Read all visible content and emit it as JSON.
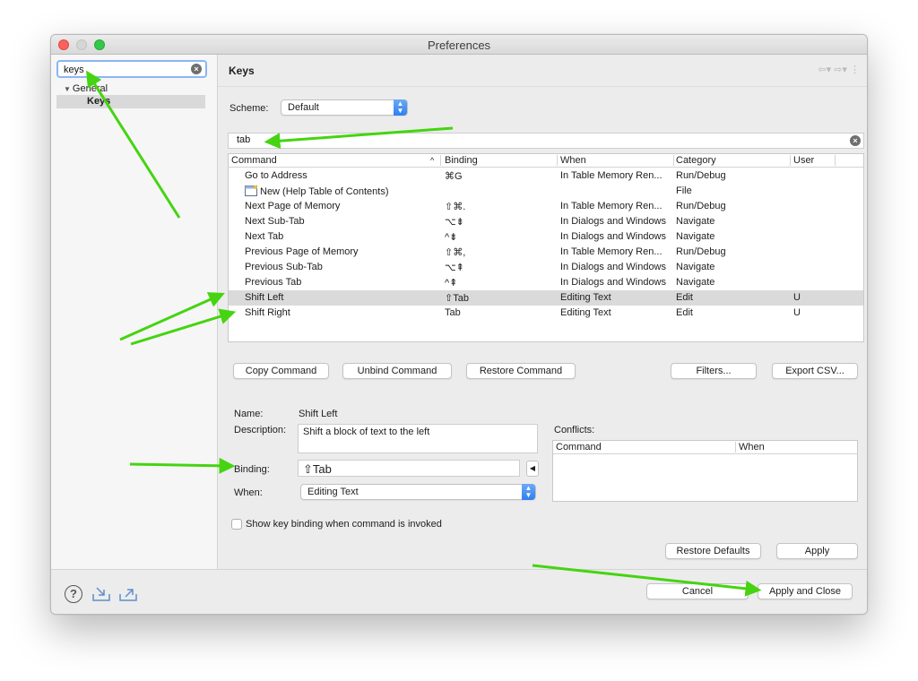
{
  "window": {
    "title": "Preferences"
  },
  "sidebar": {
    "filter_value": "keys",
    "tree": {
      "group": "General",
      "selected_item": "Keys"
    }
  },
  "page": {
    "title": "Keys"
  },
  "scheme": {
    "label": "Scheme:",
    "value": "Default"
  },
  "filter": {
    "value": "tab"
  },
  "table": {
    "columns": [
      "Command",
      "Binding",
      "When",
      "Category",
      "User"
    ],
    "rows": [
      {
        "command": "Go to Address",
        "binding": "⌘G",
        "when": "In Table Memory Ren...",
        "category": "Run/Debug",
        "user": ""
      },
      {
        "command": "New (Help Table of Contents)",
        "binding": "",
        "when": "",
        "category": "File",
        "user": "",
        "icon": "help-contents-icon"
      },
      {
        "command": "Next Page of Memory",
        "binding": "⇧⌘.",
        "when": "In Table Memory Ren...",
        "category": "Run/Debug",
        "user": ""
      },
      {
        "command": "Next Sub-Tab",
        "binding": "⌥⇟",
        "when": "In Dialogs and Windows",
        "category": "Navigate",
        "user": ""
      },
      {
        "command": "Next Tab",
        "binding": "^⇟",
        "when": "In Dialogs and Windows",
        "category": "Navigate",
        "user": ""
      },
      {
        "command": "Previous Page of Memory",
        "binding": "⇧⌘,",
        "when": "In Table Memory Ren...",
        "category": "Run/Debug",
        "user": ""
      },
      {
        "command": "Previous Sub-Tab",
        "binding": "⌥⇞",
        "when": "In Dialogs and Windows",
        "category": "Navigate",
        "user": ""
      },
      {
        "command": "Previous Tab",
        "binding": "^⇞",
        "when": "In Dialogs and Windows",
        "category": "Navigate",
        "user": ""
      },
      {
        "command": "Shift Left",
        "binding": "⇧Tab",
        "when": "Editing Text",
        "category": "Edit",
        "user": "U",
        "selected": true
      },
      {
        "command": "Shift Right",
        "binding": "Tab",
        "when": "Editing Text",
        "category": "Edit",
        "user": "U"
      }
    ]
  },
  "buttons": {
    "copy": "Copy Command",
    "unbind": "Unbind Command",
    "restore": "Restore Command",
    "filters": "Filters...",
    "export_csv": "Export CSV...",
    "restore_defaults": "Restore Defaults",
    "apply": "Apply",
    "cancel": "Cancel",
    "apply_close": "Apply and Close"
  },
  "details": {
    "name_label": "Name:",
    "name_value": "Shift Left",
    "description_label": "Description:",
    "description_value": "Shift a block of text to the left",
    "binding_label": "Binding:",
    "binding_value": "⇧Tab",
    "when_label": "When:",
    "when_value": "Editing Text"
  },
  "conflicts": {
    "label": "Conflicts:",
    "columns": [
      "Command",
      "When"
    ]
  },
  "checkbox_label": "Show key binding when command is invoked",
  "colors": {
    "accent": "#2f7ff0",
    "annotation_arrow": "#45d411",
    "selected_row": "#dadada"
  }
}
